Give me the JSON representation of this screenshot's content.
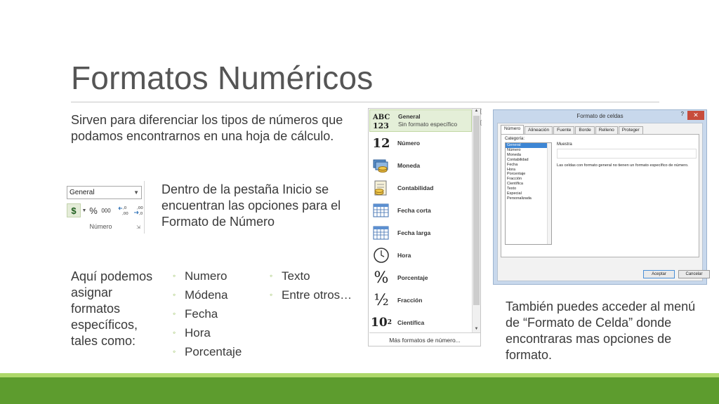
{
  "slide": {
    "title": "Formatos Numéricos",
    "intro": "Sirven para diferenciar los tipos de números que podamos encontrarnos en una hoja de cálculo.",
    "inicio_text": "Dentro de la pestaña Inicio se encuentran las opciones para el Formato de Número",
    "aqui_text": "Aquí podemos asignar formatos específicos, tales como:",
    "bullets_col1": [
      "Numero",
      "Módena",
      "Fecha",
      "Hora",
      "Porcentaje"
    ],
    "bullets_col2": [
      "Texto",
      "Entre otros…"
    ],
    "tambien_text": "También puedes acceder al menú de “Formato de Celda” donde encontraras mas opciones de formato.",
    "bullet_glyph": "◦",
    "colors": {
      "accent": "#5d9c2e",
      "accent_light": "#aed86a",
      "title": "#555555",
      "bullet": "#8ab84a"
    }
  },
  "number_group": {
    "select_value": "General",
    "currency_symbol": "$",
    "percent": "%",
    "thousands": "000",
    "inc_decimal": "←,0 ,00",
    "dec_decimal": ",00 →,0",
    "caption": "Número"
  },
  "format_dropdown": {
    "items": [
      {
        "icon_text": "ABC 123",
        "label": "General",
        "sub": "Sin formato específico",
        "selected": true
      },
      {
        "icon_text": "12",
        "label": "Número",
        "sub": ""
      },
      {
        "icon_text": "money-icon",
        "label": "Moneda",
        "sub": ""
      },
      {
        "icon_text": "accounting-icon",
        "label": "Contabilidad",
        "sub": ""
      },
      {
        "icon_text": "calendar-icon",
        "label": "Fecha corta",
        "sub": ""
      },
      {
        "icon_text": "calendar-icon",
        "label": "Fecha larga",
        "sub": ""
      },
      {
        "icon_text": "clock-icon",
        "label": "Hora",
        "sub": ""
      },
      {
        "icon_text": "%",
        "label": "Porcentaje",
        "sub": ""
      },
      {
        "icon_text": "½",
        "label": "Fracción",
        "sub": ""
      },
      {
        "icon_text": "10²",
        "label": "Científica",
        "sub": ""
      }
    ],
    "more_label": "Más formatos de número..."
  },
  "format_dialog": {
    "title": "Formato de celdas",
    "help": "?",
    "close": "✕",
    "tabs": [
      "Número",
      "Alineación",
      "Fuente",
      "Borde",
      "Relleno",
      "Proteger"
    ],
    "category_label": "Categoría:",
    "categories": [
      "General",
      "Número",
      "Moneda",
      "Contabilidad",
      "Fecha",
      "Hora",
      "Porcentaje",
      "Fracción",
      "Científica",
      "Texto",
      "Especial",
      "Personalizada"
    ],
    "sample_label": "Muestra",
    "description": "Las celdas con formato general no tienen un formato específico de número.",
    "ok": "Aceptar",
    "cancel": "Cancelar"
  }
}
